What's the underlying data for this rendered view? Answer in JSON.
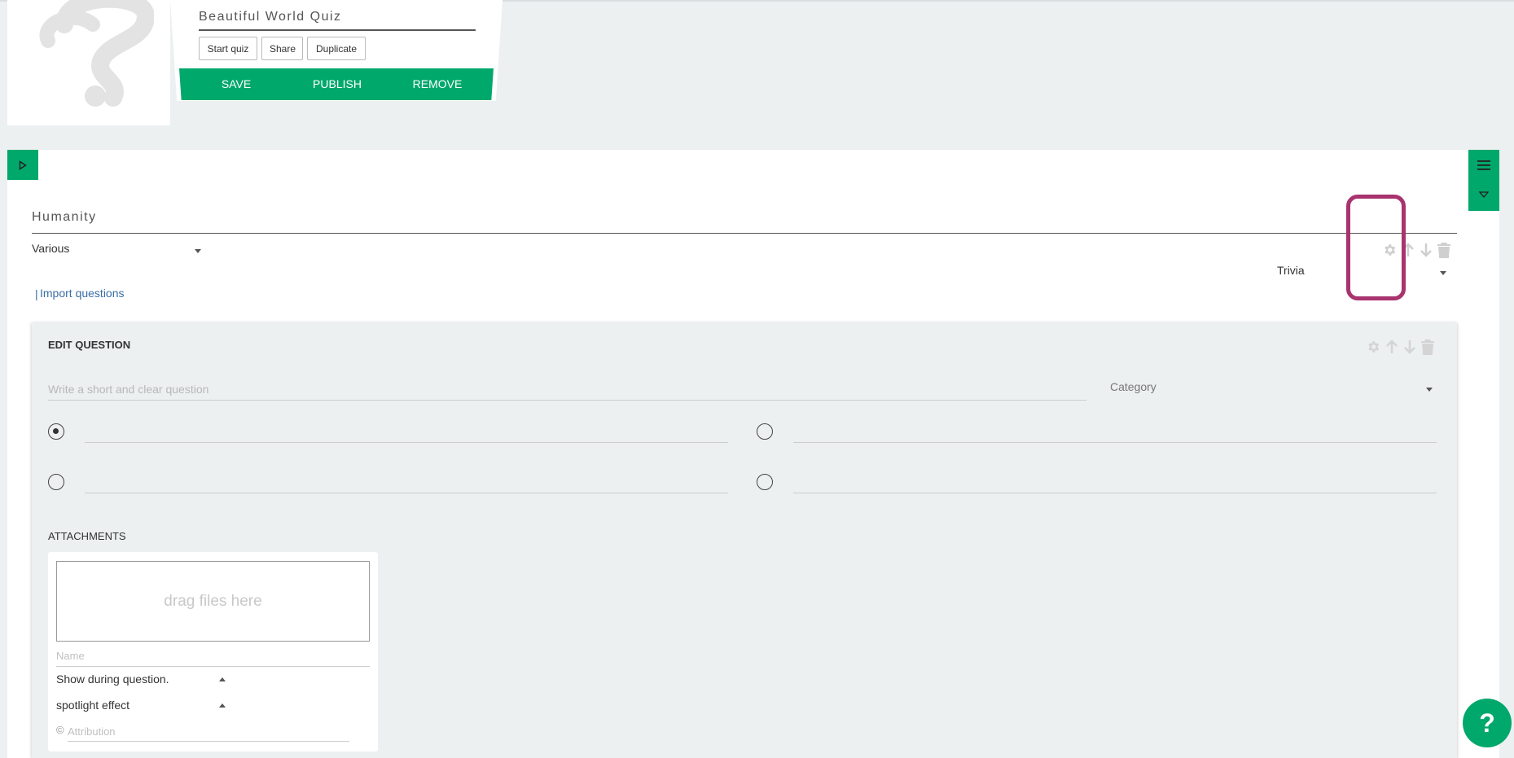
{
  "header": {
    "quiz_title": "Beautiful World Quiz",
    "buttons": {
      "start": "Start quiz",
      "share": "Share",
      "duplicate": "Duplicate"
    },
    "actions": {
      "save": "SAVE",
      "publish": "PUBLISH",
      "remove": "REMOVE"
    }
  },
  "section": {
    "title": "Humanity",
    "category_select": "Various",
    "type_select": "Trivia",
    "import_prefix": "|",
    "import_link": "Import questions"
  },
  "edit_question": {
    "title": "EDIT QUESTION",
    "question_placeholder": "Write a short and clear question",
    "category_placeholder": "Category",
    "answers": [
      "",
      "",
      "",
      ""
    ],
    "correct_index": 0
  },
  "attachments": {
    "title": "ATTACHMENTS",
    "dropzone": "drag files here",
    "name_placeholder": "Name",
    "display_select": "Show during question.",
    "effect_select": "spotlight effect",
    "attribution_symbol": "©",
    "attribution_placeholder": "Attribution"
  },
  "help": {
    "label": "?"
  },
  "colors": {
    "accent": "#00a86b",
    "highlight": "#a8336e",
    "background": "#ecf0f1"
  },
  "icons": [
    "question-mark-logo-icon",
    "play-icon",
    "menu-icon",
    "caret-down-icon",
    "gear-icon",
    "arrow-up-icon",
    "arrow-down-icon",
    "trash-icon"
  ]
}
